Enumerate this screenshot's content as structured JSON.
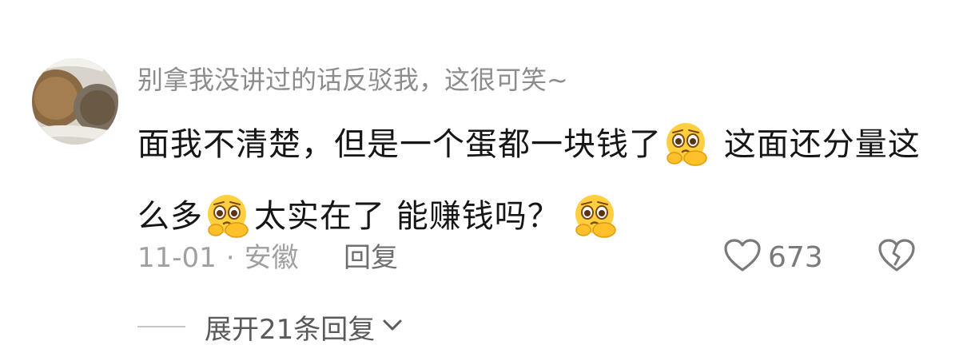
{
  "comment": {
    "username": "别拿我没讲过的话反驳我，这很可笑~",
    "text_part1": "面我不清楚，但是一个蛋都一块钱了",
    "text_part2": " 这面还分量这么多",
    "text_part3": "太实在了 能赚钱吗？ ",
    "emoji_name": "pleading-face-icon",
    "date": "11-01",
    "separator": "·",
    "location": "安徽",
    "reply_label": "回复",
    "like_count": "673",
    "expand_label": "展开21条回复"
  },
  "colors": {
    "username": "#8c8c8c",
    "body_text": "#161616",
    "meta": "#a0a0a0",
    "icon_stroke": "#7a7a7a"
  }
}
